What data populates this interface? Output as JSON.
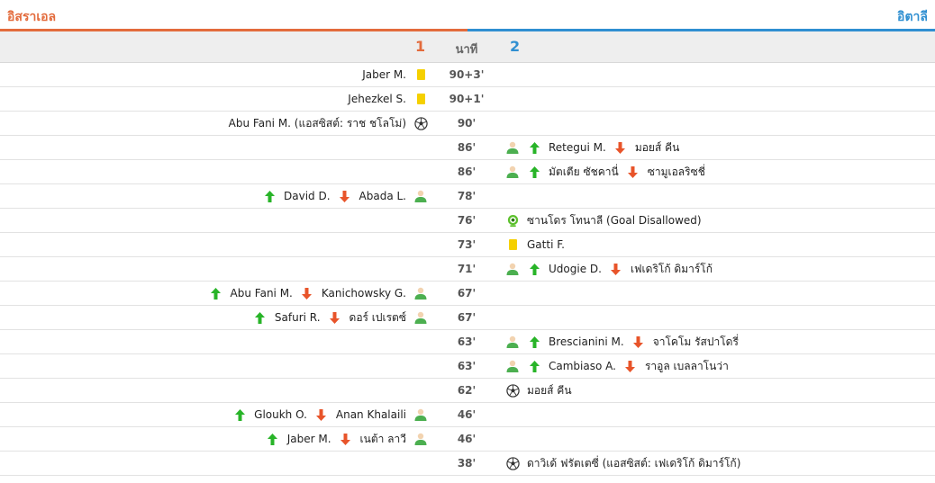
{
  "header": {
    "home_team": "อิสราเอล",
    "away_team": "อิตาลี"
  },
  "columns": {
    "home_label": "1",
    "minute_label": "นาที",
    "away_label": "2"
  },
  "colors": {
    "home": "#e36b3c",
    "away": "#2f8fd1",
    "in_arrow": "#28b428",
    "out_arrow": "#e8542a",
    "yellow": "#f5d000"
  },
  "events": [
    {
      "minute": "90+3'",
      "side": "home",
      "type": "yellow-card",
      "player": "Jaber M."
    },
    {
      "minute": "90+1'",
      "side": "home",
      "type": "yellow-card",
      "player": "Jehezkel S."
    },
    {
      "minute": "90'",
      "side": "home",
      "type": "goal",
      "player": "Abu Fani M. (แอสซิสต์: ราช ชโลโม่)"
    },
    {
      "minute": "86'",
      "side": "away",
      "type": "substitution",
      "player_in": "Retegui M.",
      "player_out": "มอยส์ คีน"
    },
    {
      "minute": "86'",
      "side": "away",
      "type": "substitution",
      "player_in": "มัตเตีย ซัชคานี่",
      "player_out": "ซามูเอลริซชี่"
    },
    {
      "minute": "78'",
      "side": "home",
      "type": "substitution",
      "player_in": "David D.",
      "player_out": "Abada L."
    },
    {
      "minute": "76'",
      "side": "away",
      "type": "var",
      "player": "ซานโดร โทนาลี (Goal Disallowed)"
    },
    {
      "minute": "73'",
      "side": "away",
      "type": "yellow-card",
      "player": "Gatti F."
    },
    {
      "minute": "71'",
      "side": "away",
      "type": "substitution",
      "player_in": "Udogie D.",
      "player_out": "เฟเดริโก้ ดิมาร์โก้"
    },
    {
      "minute": "67'",
      "side": "home",
      "type": "substitution",
      "player_in": "Abu Fani M.",
      "player_out": "Kanichowsky G."
    },
    {
      "minute": "67'",
      "side": "home",
      "type": "substitution",
      "player_in": "Safuri R.",
      "player_out": "ดอร์ เปเรตซ์"
    },
    {
      "minute": "63'",
      "side": "away",
      "type": "substitution",
      "player_in": "Brescianini M.",
      "player_out": "จาโคโม รัสปาโดรี่"
    },
    {
      "minute": "63'",
      "side": "away",
      "type": "substitution",
      "player_in": "Cambiaso A.",
      "player_out": "ราอูล เบลลาโนว่า"
    },
    {
      "minute": "62'",
      "side": "away",
      "type": "goal",
      "player": "มอยส์ คีน"
    },
    {
      "minute": "46'",
      "side": "home",
      "type": "substitution",
      "player_in": "Gloukh O.",
      "player_out": "Anan Khalaili"
    },
    {
      "minute": "46'",
      "side": "home",
      "type": "substitution",
      "player_in": "Jaber M.",
      "player_out": "เนต้า ลาวี"
    },
    {
      "minute": "38'",
      "side": "away",
      "type": "goal",
      "player": "ดาวิเด้ ฟรัตเตซี่ (แอสซิสต์: เฟเดริโก้ ดิมาร์โก้)"
    }
  ]
}
